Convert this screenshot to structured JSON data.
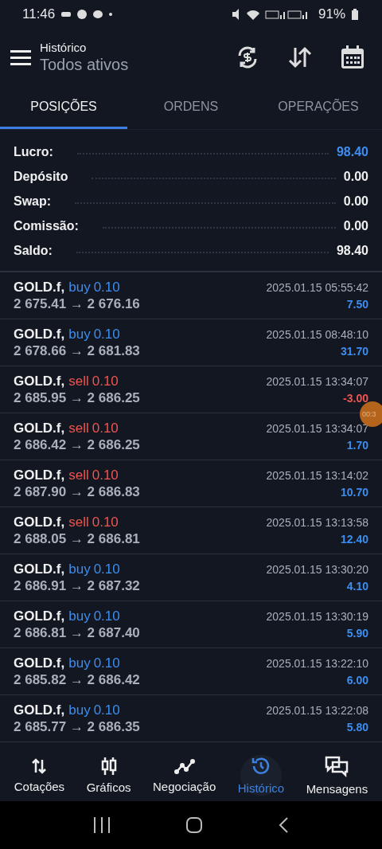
{
  "status_bar": {
    "time": "11:46",
    "battery": "91%"
  },
  "header": {
    "title": "Histórico",
    "subtitle": "Todos ativos"
  },
  "tabs": [
    {
      "label": "POSIÇÕES",
      "selected": true
    },
    {
      "label": "ORDENS",
      "selected": false
    },
    {
      "label": "OPERAÇÕES",
      "selected": false
    }
  ],
  "summary": [
    {
      "label": "Lucro:",
      "value": "98.40",
      "highlight": true
    },
    {
      "label": "Depósito",
      "value": "0.00",
      "highlight": false
    },
    {
      "label": "Swap:",
      "value": "0.00",
      "highlight": false
    },
    {
      "label": "Comissão:",
      "value": "0.00",
      "highlight": false
    },
    {
      "label": "Saldo:",
      "value": "98.40",
      "highlight": false
    }
  ],
  "deals": [
    {
      "symbol": "GOLD.f,",
      "side": "buy",
      "volume": "0.10",
      "color": "#3d8ef0",
      "prices": "2 675.41 → 2 676.16",
      "time": "2025.01.15 05:55:42",
      "profit": "7.50",
      "loss": false
    },
    {
      "symbol": "GOLD.f,",
      "side": "buy",
      "volume": "0.10",
      "color": "#3d8ef0",
      "prices": "2 678.66 → 2 681.83",
      "time": "2025.01.15 08:48:10",
      "profit": "31.70",
      "loss": false
    },
    {
      "symbol": "GOLD.f,",
      "side": "sell",
      "volume": "0.10",
      "color": "#f0554f",
      "prices": "2 685.95 → 2 686.25",
      "time": "2025.01.15 13:34:07",
      "profit": "-3.00",
      "loss": true
    },
    {
      "symbol": "GOLD.f,",
      "side": "sell",
      "volume": "0.10",
      "color": "#f0554f",
      "prices": "2 686.42 → 2 686.25",
      "time": "2025.01.15 13:34:07",
      "profit": "1.70",
      "loss": false
    },
    {
      "symbol": "GOLD.f,",
      "side": "sell",
      "volume": "0.10",
      "color": "#f0554f",
      "prices": "2 687.90 → 2 686.83",
      "time": "2025.01.15 13:14:02",
      "profit": "10.70",
      "loss": false
    },
    {
      "symbol": "GOLD.f,",
      "side": "sell",
      "volume": "0.10",
      "color": "#f0554f",
      "prices": "2 688.05 → 2 686.81",
      "time": "2025.01.15 13:13:58",
      "profit": "12.40",
      "loss": false
    },
    {
      "symbol": "GOLD.f,",
      "side": "buy",
      "volume": "0.10",
      "color": "#3d8ef0",
      "prices": "2 686.91 → 2 687.32",
      "time": "2025.01.15 13:30:20",
      "profit": "4.10",
      "loss": false
    },
    {
      "symbol": "GOLD.f,",
      "side": "buy",
      "volume": "0.10",
      "color": "#3d8ef0",
      "prices": "2 686.81 → 2 687.40",
      "time": "2025.01.15 13:30:19",
      "profit": "5.90",
      "loss": false
    },
    {
      "symbol": "GOLD.f,",
      "side": "buy",
      "volume": "0.10",
      "color": "#3d8ef0",
      "prices": "2 685.82 → 2 686.42",
      "time": "2025.01.15 13:22:10",
      "profit": "6.00",
      "loss": false
    },
    {
      "symbol": "GOLD.f,",
      "side": "buy",
      "volume": "0.10",
      "color": "#3d8ef0",
      "prices": "2 685.77 → 2 686.35",
      "time": "2025.01.15 13:22:08",
      "profit": "5.80",
      "loss": false
    }
  ],
  "recorder_badge": {
    "text": "00:3"
  },
  "bottom_nav": [
    {
      "label": "Cotações",
      "kind": "quotes",
      "selected": false
    },
    {
      "label": "Gráficos",
      "kind": "charts",
      "selected": false
    },
    {
      "label": "Negociação",
      "kind": "trade",
      "selected": false
    },
    {
      "label": "Histórico",
      "kind": "history",
      "selected": true
    },
    {
      "label": "Mensagens",
      "kind": "messages",
      "selected": false
    }
  ]
}
